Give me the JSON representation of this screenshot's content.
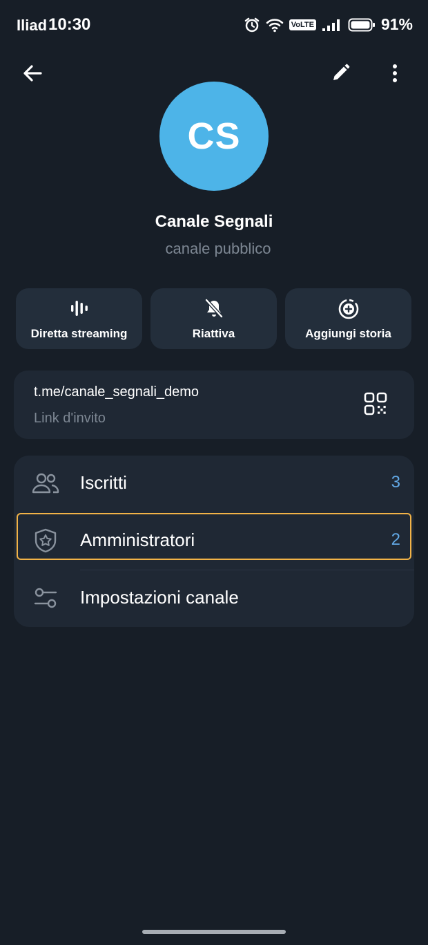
{
  "status_bar": {
    "carrier": "Iliad",
    "time": "10:30",
    "volte": "VoLTE",
    "battery": "91%",
    "icons": [
      "alarm-icon",
      "wifi-icon",
      "volte-icon",
      "signal-icon",
      "battery-icon"
    ]
  },
  "toolbar": {
    "back_icon": "arrow-left-icon",
    "edit_icon": "pencil-icon",
    "more_icon": "more-vertical-icon"
  },
  "profile": {
    "avatar_initials": "CS",
    "avatar_color": "#4db4e8",
    "name": "Canale Segnali",
    "subtitle": "canale pubblico"
  },
  "actions": [
    {
      "label": "Diretta streaming",
      "icon": "live-stream-icon"
    },
    {
      "label": "Riattiva",
      "icon": "bell-off-icon"
    },
    {
      "label": "Aggiungi storia",
      "icon": "add-story-icon"
    }
  ],
  "invite": {
    "url": "t.me/canale_segnali_demo",
    "caption": "Link d'invito",
    "icon": "qr-code-icon"
  },
  "menu": [
    {
      "label": "Iscritti",
      "count": "3",
      "icon": "users-icon"
    },
    {
      "label": "Amministratori",
      "count": "2",
      "icon": "shield-star-icon"
    },
    {
      "label": "Impostazioni canale",
      "count": "",
      "icon": "sliders-icon"
    }
  ],
  "colors": {
    "background": "#171e27",
    "card": "#1f2834",
    "button": "#232e3b",
    "accent": "#62a9e6",
    "highlight": "#f2b347"
  }
}
